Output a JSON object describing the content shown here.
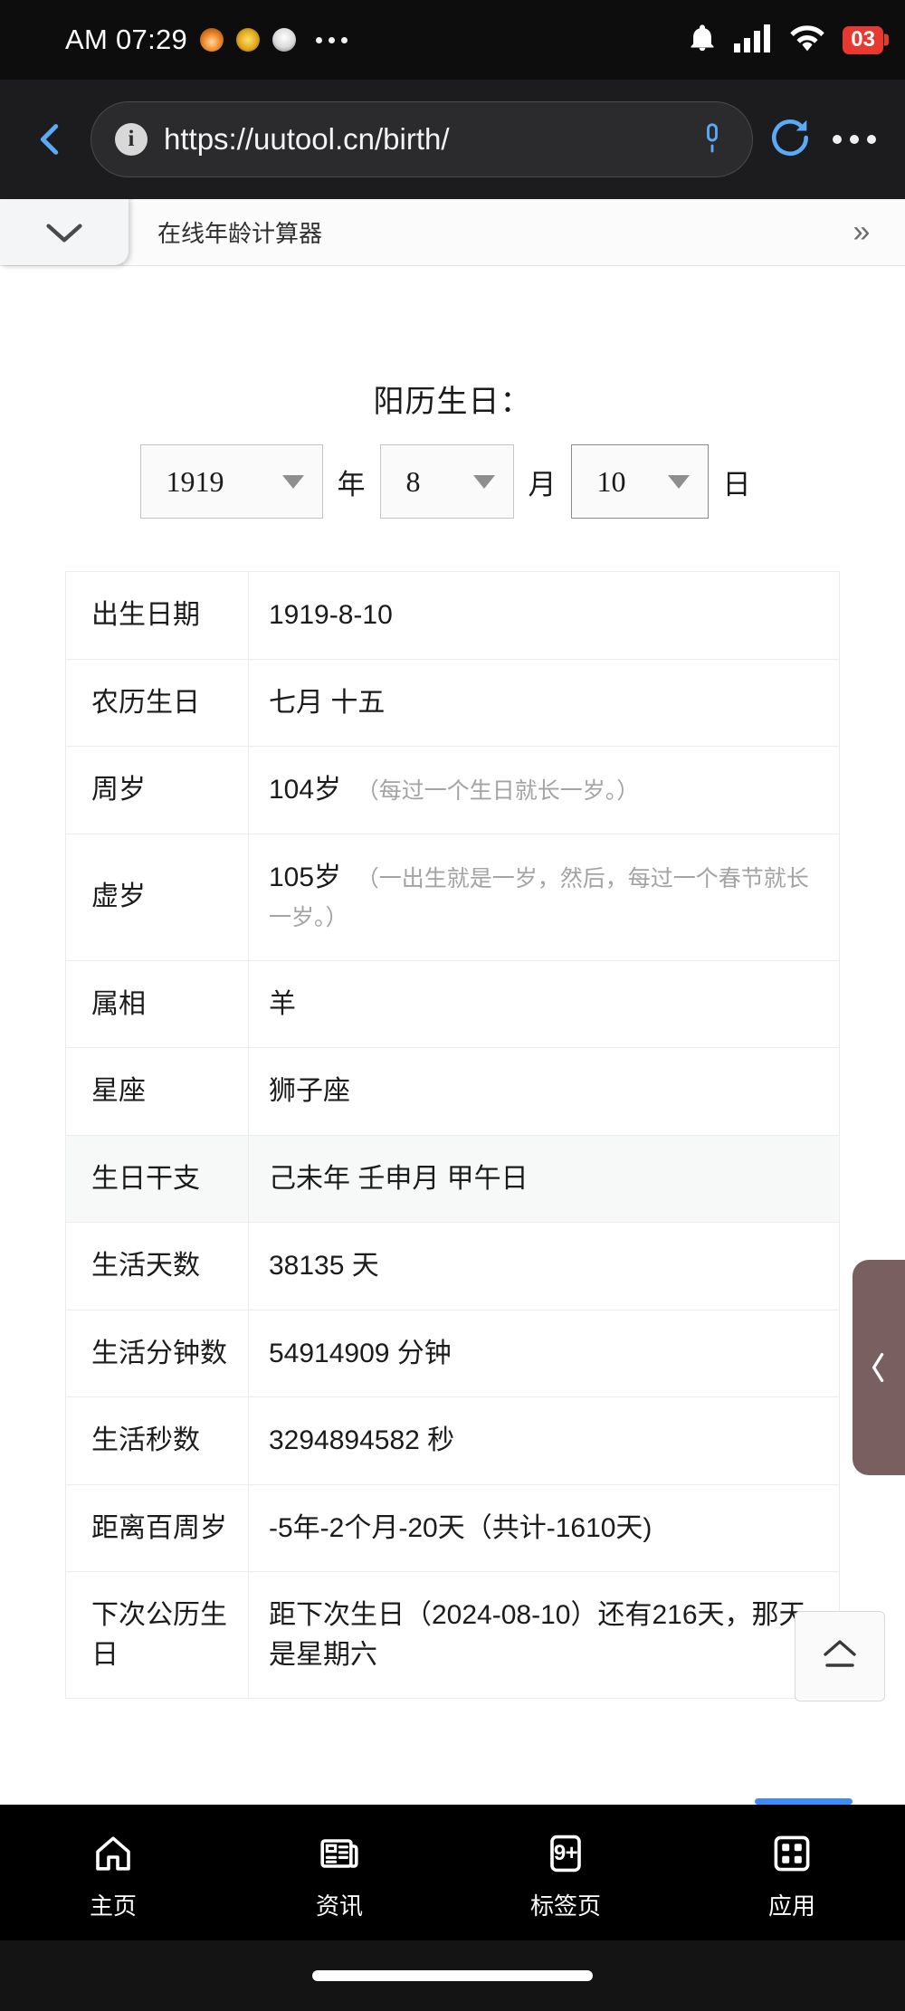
{
  "status_bar": {
    "clock": "AM 07:29",
    "tray_icons": [
      "flame-icon",
      "badge-icon",
      "ghost-icon"
    ],
    "overflow": "more-icon",
    "notification_icon": "bell-icon",
    "signal_icon": "cellular-signal-icon",
    "wifi_icon": "wifi-icon",
    "battery_level": "03"
  },
  "browser": {
    "back_label": "back-chevron-icon",
    "url": "https://uutool.cn/birth/",
    "info_symbol": "i",
    "mic_label": "microphone-icon",
    "reload_label": "reload-icon",
    "menu_label": "overflow-menu-icon"
  },
  "tabs": {
    "collapse_label": "chevron-down-icon",
    "active_title": "在线年龄计算器",
    "more_label": "»"
  },
  "form": {
    "title": "阳历生日：",
    "year": {
      "value": "1919",
      "unit": "年"
    },
    "month": {
      "value": "8",
      "unit": "月"
    },
    "day": {
      "value": "10",
      "unit": "日"
    }
  },
  "table": {
    "rows": [
      {
        "key": "出生日期",
        "value": "1919-8-10",
        "note": "",
        "alt": false
      },
      {
        "key": "农历生日",
        "value": "七月 十五",
        "note": "",
        "alt": false
      },
      {
        "key": "周岁",
        "value": "104岁",
        "note": "（每过一个生日就长一岁。）",
        "alt": false
      },
      {
        "key": "虚岁",
        "value": "105岁",
        "note": "（一出生就是一岁，然后，每过一个春节就长一岁。）",
        "alt": false
      },
      {
        "key": "属相",
        "value": "羊",
        "note": "",
        "alt": false
      },
      {
        "key": "星座",
        "value": "狮子座",
        "note": "",
        "alt": false
      },
      {
        "key": "生日干支",
        "value": "己未年 壬申月 甲午日",
        "note": "",
        "alt": true
      },
      {
        "key": "生活天数",
        "value": "38135 天",
        "note": "",
        "alt": false
      },
      {
        "key": "生活分钟数",
        "value": "54914909 分钟",
        "note": "",
        "alt": false
      },
      {
        "key": "生活秒数",
        "value": "3294894582 秒",
        "note": "",
        "alt": false
      },
      {
        "key": "距离百周岁",
        "value": "-5年-2个月-20天（共计-1610天)",
        "note": "",
        "alt": false
      },
      {
        "key": "下次公历生日",
        "value": "距下次生日（2024-08-10）还有216天，那天是星期六",
        "note": "",
        "alt": false
      }
    ]
  },
  "overlays": {
    "side_handle": "collapse-panel-handle",
    "back_to_top": "back-to-top-button"
  },
  "bottom_nav": {
    "items": [
      {
        "icon": "home-icon",
        "label": "主页",
        "badge": ""
      },
      {
        "icon": "news-icon",
        "label": "资讯",
        "badge": ""
      },
      {
        "icon": "tabs-icon",
        "label": "标签页",
        "badge": "9+"
      },
      {
        "icon": "apps-grid-icon",
        "label": "应用",
        "badge": ""
      }
    ]
  },
  "colors": {
    "accent_blue": "#5aaaf5",
    "battery_red": "#e8382f",
    "handle_mauve": "#7a5f60",
    "alt_row": "#f7f8f8"
  }
}
